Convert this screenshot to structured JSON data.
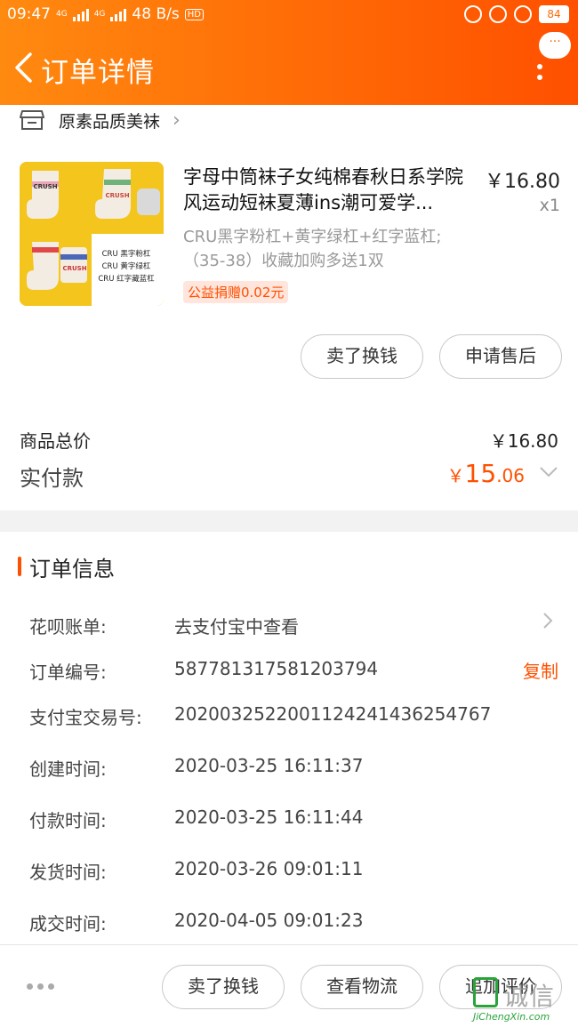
{
  "status_bar": {
    "time": "09:47",
    "sim_labels": [
      "4G",
      "4G"
    ],
    "speed": "48 B/s",
    "hd": "HD",
    "battery": "84"
  },
  "header": {
    "title": "订单详情",
    "more_bubble": "···"
  },
  "shop": {
    "name": "原素品质美袜"
  },
  "product": {
    "title": "字母中筒袜子女纯棉春秋日系学院风运动短袜夏薄ins潮可爱学...",
    "price": "￥16.80",
    "qty": "x1",
    "sku": "CRU黑字粉杠+黄字绿杠+红字蓝杠;（35-38）收藏加购多送1双",
    "charity": "公益捐赠0.02元",
    "thumb_brand": "CRUSH",
    "thumb_legend": [
      "CRU 黑字粉杠",
      "CRU 黄字绿杠",
      "CRU 红字藏蓝杠"
    ],
    "actions": [
      "卖了换钱",
      "申请售后"
    ]
  },
  "totals": {
    "total_label": "商品总价",
    "total_value": "￥16.80",
    "paid_label": "实付款",
    "paid_currency": "￥",
    "paid_int": "15",
    "paid_dec": ".06"
  },
  "order_info": {
    "title": "订单信息",
    "rows": [
      {
        "label": "花呗账单:",
        "value": "去支付宝中查看"
      },
      {
        "label": "订单编号:",
        "value": "587781317581203794"
      },
      {
        "label": "支付宝交易号:",
        "value": "2020032522001124241436254767"
      },
      {
        "label": "创建时间:",
        "value": "2020-03-25 16:11:37"
      },
      {
        "label": "付款时间:",
        "value": "2020-03-25 16:11:44"
      },
      {
        "label": "发货时间:",
        "value": "2020-03-26 09:01:11"
      },
      {
        "label": "成交时间:",
        "value": "2020-04-05 09:01:23"
      }
    ],
    "copy_label": "复制"
  },
  "bottom_bar": {
    "buttons": [
      "卖了换钱",
      "查看物流",
      "追加评价"
    ]
  },
  "watermark": {
    "text": "诚信",
    "sub": "JiChengXin.com"
  },
  "colors": {
    "accent": "#ff5000",
    "header_start": "#ff8a10",
    "header_end": "#ff5000"
  }
}
